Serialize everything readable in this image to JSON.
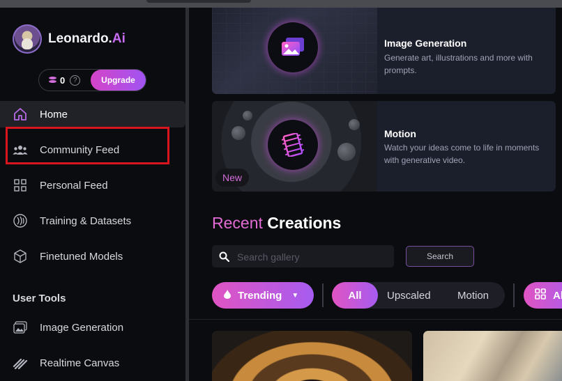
{
  "brand": {
    "name": "Leonardo.",
    "accent": "Ai"
  },
  "credits": {
    "count": "0",
    "help": "?",
    "upgrade_label": "Upgrade"
  },
  "nav": {
    "home": "Home",
    "community_feed": "Community Feed",
    "personal_feed": "Personal Feed",
    "training": "Training & Datasets",
    "finetuned": "Finetuned Models"
  },
  "user_tools": {
    "title": "User Tools",
    "image_generation": "Image Generation",
    "realtime_canvas": "Realtime Canvas"
  },
  "feature_cards": [
    {
      "title": "Image Generation",
      "description": "Generate art, illustrations and more with prompts."
    },
    {
      "title": "Motion",
      "description": "Watch your ideas come to life in moments with generative video.",
      "badge": "New"
    }
  ],
  "recent": {
    "accent": "Recent",
    "title": "Creations"
  },
  "search": {
    "placeholder": "Search gallery",
    "button_label": "Search"
  },
  "filters": {
    "trending": "Trending",
    "options": [
      "All",
      "Upscaled",
      "Motion"
    ],
    "selected": "All",
    "models_partial": "Al"
  },
  "colors": {
    "accent_pink": "#e054c2",
    "accent_purple": "#a65cf0",
    "highlight": "#d8141f"
  }
}
